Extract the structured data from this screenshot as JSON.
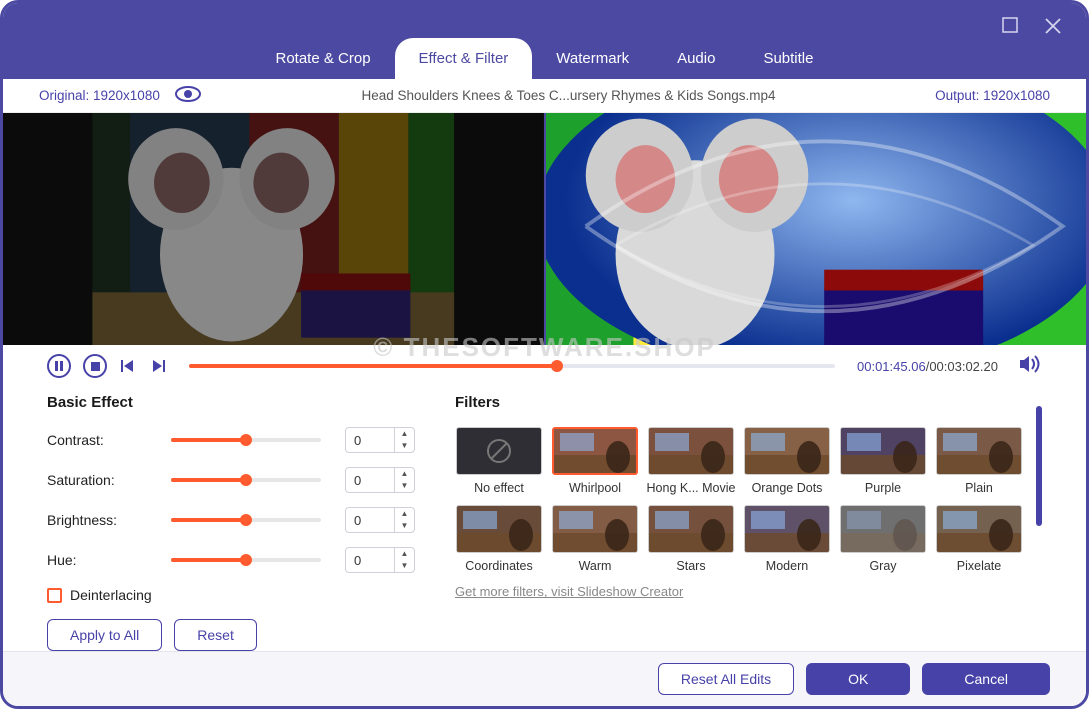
{
  "tabs": [
    "Rotate & Crop",
    "Effect & Filter",
    "Watermark",
    "Audio",
    "Subtitle"
  ],
  "active_tab": 1,
  "info": {
    "original": "Original: 1920x1080",
    "title": "Head Shoulders Knees & Toes  C...ursery Rhymes & Kids Songs.mp4",
    "output": "Output: 1920x1080"
  },
  "player": {
    "current_time": "00:01:45.06",
    "duration": "00:03:02.20",
    "progress_pct": 57
  },
  "basic_effect": {
    "title": "Basic Effect",
    "rows": [
      {
        "label": "Contrast:",
        "value": 0,
        "fill_pct": 50
      },
      {
        "label": "Saturation:",
        "value": 0,
        "fill_pct": 50
      },
      {
        "label": "Brightness:",
        "value": 0,
        "fill_pct": 50
      },
      {
        "label": "Hue:",
        "value": 0,
        "fill_pct": 50
      }
    ],
    "deinterlacing": "Deinterlacing",
    "apply_all": "Apply to All",
    "reset": "Reset"
  },
  "filters": {
    "title": "Filters",
    "items": [
      {
        "label": "No effect",
        "kind": "none"
      },
      {
        "label": "Whirlpool",
        "kind": "whirl",
        "selected": true
      },
      {
        "label": "Hong K... Movie",
        "kind": "hk"
      },
      {
        "label": "Orange Dots",
        "kind": "dots"
      },
      {
        "label": "Purple",
        "kind": "purple"
      },
      {
        "label": "Plain",
        "kind": "plain"
      },
      {
        "label": "Coordinates",
        "kind": "coord"
      },
      {
        "label": "Warm",
        "kind": "warm"
      },
      {
        "label": "Stars",
        "kind": "stars"
      },
      {
        "label": "Modern",
        "kind": "modern"
      },
      {
        "label": "Gray",
        "kind": "gray"
      },
      {
        "label": "Pixelate",
        "kind": "pixel"
      }
    ],
    "more": "Get more filters, visit Slideshow Creator"
  },
  "footer": {
    "reset_all": "Reset All Edits",
    "ok": "OK",
    "cancel": "Cancel"
  },
  "watermark": "© THESOFTWARE.SHOP"
}
